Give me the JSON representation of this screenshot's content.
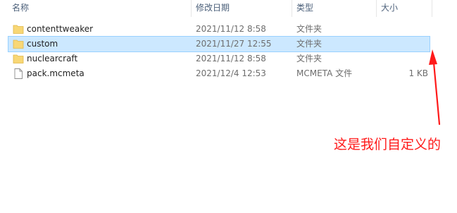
{
  "header": {
    "name_label": "名称",
    "date_label": "修改日期",
    "type_label": "类型",
    "size_label": "大小"
  },
  "files": [
    {
      "name": "contenttweaker",
      "date": "2021/11/12 8:58",
      "type": "文件夹",
      "size": "",
      "icon": "folder-icon",
      "selected": false
    },
    {
      "name": "custom",
      "date": "2021/11/27 12:55",
      "type": "文件夹",
      "size": "",
      "icon": "folder-icon",
      "selected": true
    },
    {
      "name": "nuclearcraft",
      "date": "2021/11/12 8:58",
      "type": "文件夹",
      "size": "",
      "icon": "folder-icon",
      "selected": false
    },
    {
      "name": "pack.mcmeta",
      "date": "2021/12/4 12:53",
      "type": "MCMETA 文件",
      "size": "1 KB",
      "icon": "file-icon",
      "selected": false
    }
  ],
  "annotation": {
    "text": "这是我们自定义的",
    "color": "#ff1a1a"
  },
  "colors": {
    "selection_bg": "#cce8ff",
    "selection_border": "#99d1ff",
    "folder": "#f8d775"
  }
}
